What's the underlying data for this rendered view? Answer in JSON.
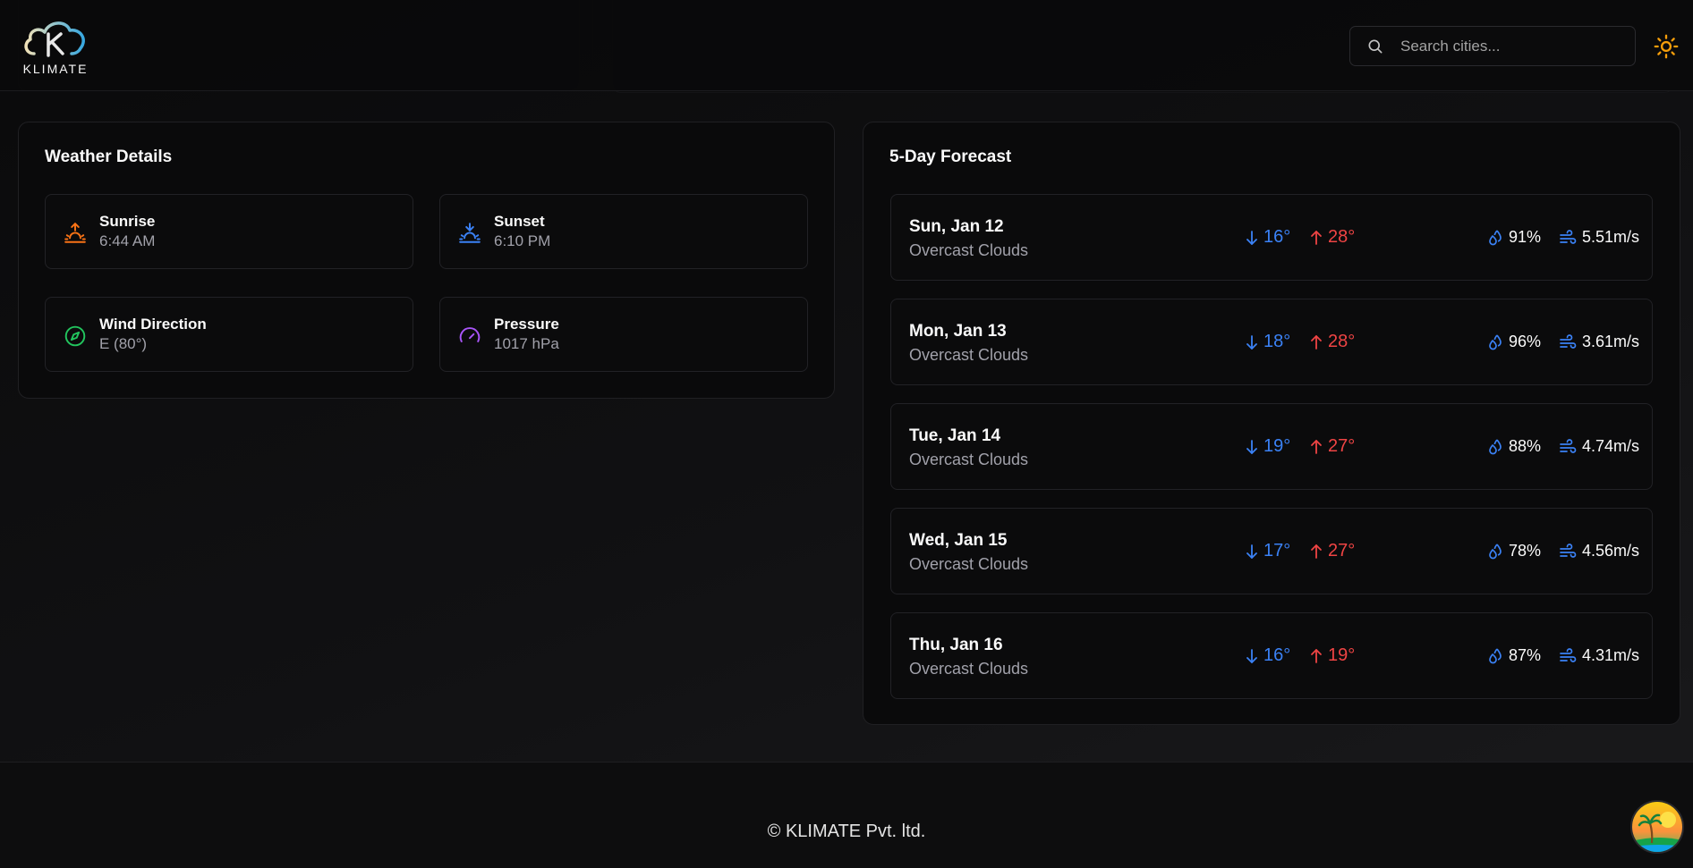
{
  "header": {
    "logo_text": "KLIMATE",
    "search": {
      "placeholder": "Search cities..."
    },
    "icons": {
      "search": "search-icon",
      "theme": "sun-icon"
    }
  },
  "details": {
    "title": "Weather Details",
    "items": [
      {
        "label": "Sunrise",
        "value": "6:44 AM",
        "icon": "sunrise-icon",
        "color": "#f97316"
      },
      {
        "label": "Sunset",
        "value": "6:10 PM",
        "icon": "sunset-icon",
        "color": "#3b82f6"
      },
      {
        "label": "Wind Direction",
        "value": "E (80°)",
        "icon": "compass-icon",
        "color": "#22c55e"
      },
      {
        "label": "Pressure",
        "value": "1017 hPa",
        "icon": "gauge-icon",
        "color": "#a855f7"
      }
    ]
  },
  "forecast": {
    "title": "5-Day Forecast",
    "days": [
      {
        "date": "Sun, Jan 12",
        "desc": "Overcast Clouds",
        "min": "16°",
        "max": "28°",
        "humidity": "91%",
        "wind": "5.51m/s"
      },
      {
        "date": "Mon, Jan 13",
        "desc": "Overcast Clouds",
        "min": "18°",
        "max": "28°",
        "humidity": "96%",
        "wind": "3.61m/s"
      },
      {
        "date": "Tue, Jan 14",
        "desc": "Overcast Clouds",
        "min": "19°",
        "max": "27°",
        "humidity": "88%",
        "wind": "4.74m/s"
      },
      {
        "date": "Wed, Jan 15",
        "desc": "Overcast Clouds",
        "min": "17°",
        "max": "27°",
        "humidity": "78%",
        "wind": "4.56m/s"
      },
      {
        "date": "Thu, Jan 16",
        "desc": "Overcast Clouds",
        "min": "16°",
        "max": "19°",
        "humidity": "87%",
        "wind": "4.31m/s"
      }
    ]
  },
  "footer": {
    "text": "© KLIMATE Pvt. ltd."
  },
  "colors": {
    "min_temp": "#3b82f6",
    "max_temp": "#ef4444",
    "humidity_icon": "#3b82f6",
    "wind_icon": "#3b82f6",
    "theme_icon": "#f59e0b"
  }
}
